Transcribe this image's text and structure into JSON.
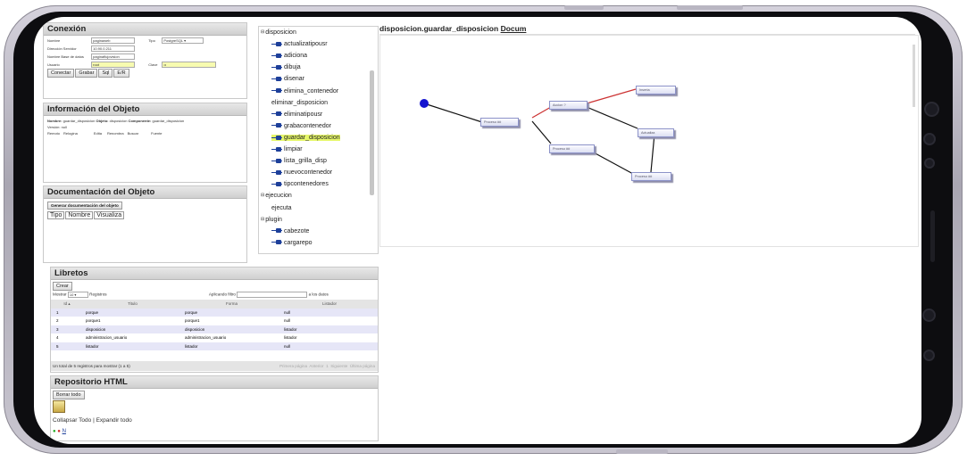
{
  "conexion": {
    "title": "Conexión",
    "labels": {
      "nombre": "Nombre",
      "direccion": "Dirección Servidor",
      "base": "Nombre Base de datos",
      "usuario": "Usuario",
      "tipo": "Tipo",
      "clave": "Clave"
    },
    "values": {
      "nombre": "paginaweb",
      "direccion": "10.90.0.211",
      "base": "paginaflujovision",
      "usuario": "root",
      "tipo": "PostgreSQL",
      "clave": "••"
    },
    "buttons": [
      "Conectar",
      "Grabar",
      "Sql",
      "E/R"
    ]
  },
  "informacion": {
    "title": "Información del Objeto",
    "nombre_label": "Nombre:",
    "nombre": "guardar_disposicion",
    "objeto_label": "Objeto:",
    "objeto": "disposicion",
    "componente_label": "Componente:",
    "componente": "guardar_disposicion",
    "version_label": "Versión:",
    "version": "null",
    "actions": [
      "Remoto",
      "Relogina",
      "Edita",
      "Renombra",
      "Buscar",
      "Fuente"
    ]
  },
  "documentacion": {
    "title": "Documentación del Objeto",
    "generate_button": "Generar documentación del objeto",
    "cols": [
      "Tipo",
      "Nombre",
      "Visualiza"
    ]
  },
  "tree": {
    "items": [
      {
        "label": "disposicion",
        "type": "folder"
      },
      {
        "label": "actualizatipousr",
        "type": "method"
      },
      {
        "label": "adiciona",
        "type": "method"
      },
      {
        "label": "dibuja",
        "type": "method"
      },
      {
        "label": "disenar",
        "type": "method"
      },
      {
        "label": "elimina_contenedor",
        "type": "method"
      },
      {
        "label": "eliminar_disposicion",
        "type": "plain"
      },
      {
        "label": "eliminatipousr",
        "type": "method"
      },
      {
        "label": "grabacontenedor",
        "type": "method"
      },
      {
        "label": "guardar_disposicion",
        "type": "method",
        "selected": true
      },
      {
        "label": "limpiar",
        "type": "method"
      },
      {
        "label": "lista_grilla_disp",
        "type": "method"
      },
      {
        "label": "nuevocontenedor",
        "type": "method"
      },
      {
        "label": "tipcontenedores",
        "type": "method"
      },
      {
        "label": "ejecucion",
        "type": "folder"
      },
      {
        "label": "ejecuta",
        "type": "plain"
      },
      {
        "label": "plugin",
        "type": "folder"
      },
      {
        "label": "cabezote",
        "type": "method"
      },
      {
        "label": "cargarepo",
        "type": "method"
      }
    ]
  },
  "diagram": {
    "title": "disposicion.guardar_disposicion",
    "link": "Docum",
    "nodes": [
      "Proceso ##",
      "Accion ?",
      "Inserta",
      "Actualiza",
      "Proceso ##",
      "Proceso ##"
    ]
  },
  "libretos": {
    "title": "Libretos",
    "create_button": "Crear",
    "mostrar_label": "Mostrar",
    "mostrar_value": "10",
    "registros_label": "Registros",
    "filtro_label": "Aplicando filtro",
    "filtro_suffix": "a los datos",
    "columns": [
      "Id",
      "Titulo",
      "Forma",
      "Listador"
    ],
    "rows": [
      [
        "1",
        "porque",
        "porque",
        "null"
      ],
      [
        "2",
        "porque1",
        "porque1",
        "null"
      ],
      [
        "3",
        "disposicion",
        "disposicion",
        "listador"
      ],
      [
        "4",
        "administracion_usuario",
        "administracion_usuario",
        "listador"
      ],
      [
        "5",
        "listador",
        "listador",
        "null"
      ]
    ],
    "footer": "Un total de 5 registros para mostrar (1 a 5)",
    "pager": [
      "Primera página",
      "Anterior",
      "1",
      "Siguiente",
      "Última página"
    ]
  },
  "repositorio": {
    "title": "Repositorio HTML",
    "delete_button": "Borrar todo",
    "collapse": "Collapsar Todo",
    "sep": "|",
    "expand": "Expandir todo",
    "last_link": "N"
  },
  "colors": {
    "accent": "#1d3f9a",
    "highlight": "#e6f76a",
    "row_alt": "#e6e6f7"
  }
}
